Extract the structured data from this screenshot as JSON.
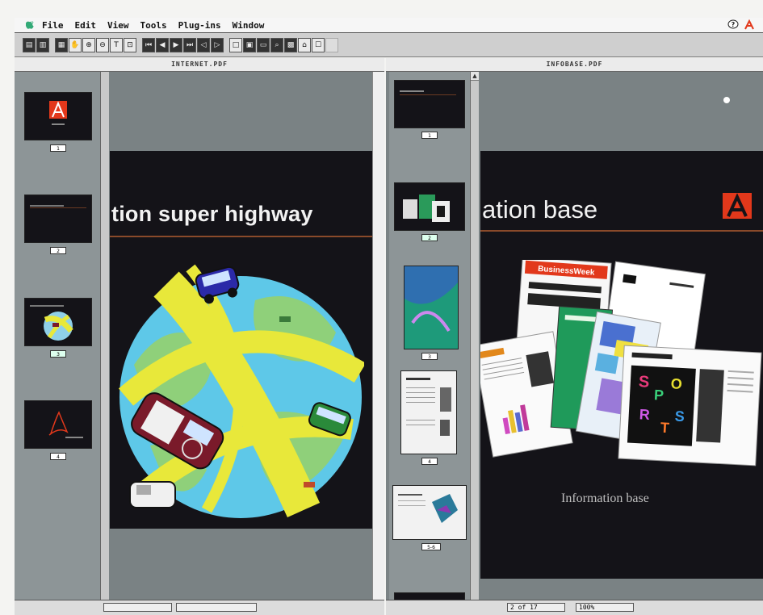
{
  "menubar": {
    "items": [
      "File",
      "Edit",
      "View",
      "Tools",
      "Plug-ins",
      "Window"
    ]
  },
  "toolbar": {
    "tools": [
      "hand-tool-icon",
      "zoom-in-icon",
      "zoom-out-icon",
      "text-select-icon",
      "graphics-select-icon",
      "first-page-icon",
      "previous-page-icon",
      "next-page-icon",
      "last-page-icon",
      "go-back-icon",
      "go-forward-icon",
      "actual-size-icon",
      "fit-page-icon",
      "fit-width-icon",
      "find-icon",
      "thumbnails-icon",
      "bookmarks-icon"
    ]
  },
  "left_window": {
    "title": "INTERNET.PDF",
    "headline": "tion super highway",
    "thumbnails": [
      {
        "label": "1",
        "selected": false
      },
      {
        "label": "2",
        "selected": false
      },
      {
        "label": "3",
        "selected": true
      },
      {
        "label": "4",
        "selected": false
      }
    ],
    "status": {
      "page": "",
      "zoom": ""
    }
  },
  "right_window": {
    "title": "INFOBASE.PDF",
    "headline": "ation base",
    "footer": "Information base",
    "thumbnails": [
      {
        "label": "1",
        "selected": false
      },
      {
        "label": "2",
        "selected": true
      },
      {
        "label": "3",
        "selected": false
      },
      {
        "label": "4",
        "selected": false
      },
      {
        "label": "5-6",
        "selected": false
      }
    ],
    "status": {
      "page": "2 of 17",
      "zoom": "100%"
    }
  },
  "colors": {
    "page_dark": "#141318",
    "workspace_gray": "#7b8385",
    "adobe_red": "#e2381b",
    "rule_brown": "#8a4a2a"
  }
}
